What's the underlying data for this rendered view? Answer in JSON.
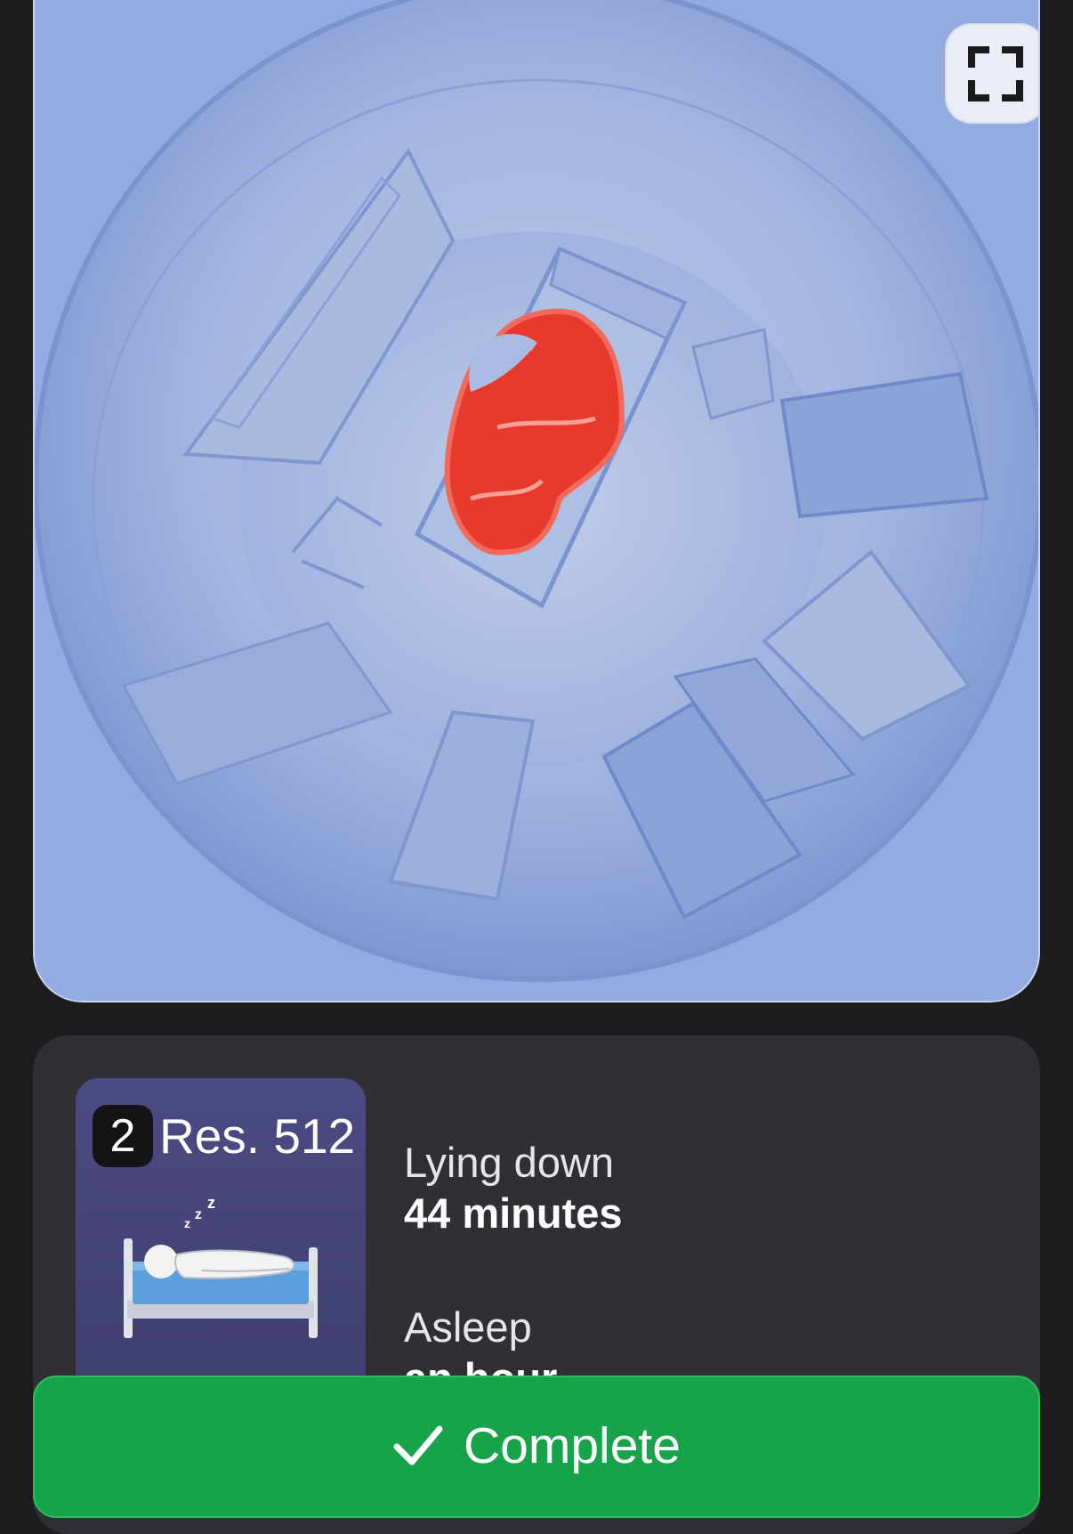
{
  "camera": {
    "fullscreen_icon": "fullscreen-icon",
    "highlight_color": "#e83a2c",
    "view_color": "#93abe0"
  },
  "room_card": {
    "room_number": "2",
    "room_label": "Res. 512",
    "illustration_icon": "sleeping-in-bed-icon"
  },
  "stats": [
    {
      "label": "Lying down",
      "value": "44 minutes"
    },
    {
      "label": "Asleep",
      "value": "an hour"
    }
  ],
  "complete_button": {
    "label": "Complete",
    "icon": "checkmark-icon",
    "color": "#16a34a"
  }
}
